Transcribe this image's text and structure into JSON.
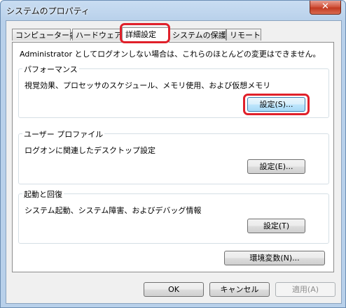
{
  "window": {
    "title": "システムのプロパティ",
    "close_glyph": "✕"
  },
  "tabs": [
    {
      "label": "コンピューター名"
    },
    {
      "label": "ハードウェア"
    },
    {
      "label": "詳細設定"
    },
    {
      "label": "システムの保護"
    },
    {
      "label": "リモート"
    }
  ],
  "panel": {
    "notice": "Administrator としてログオンしない場合は、これらのほとんどの変更はできません。",
    "performance": {
      "label": "パフォーマンス",
      "description": "視覚効果、プロセッサのスケジュール、メモリ使用、および仮想メモリ",
      "button": "設定(S)..."
    },
    "user_profile": {
      "label": "ユーザー プロファイル",
      "description": "ログオンに関連したデスクトップ設定",
      "button": "設定(E)..."
    },
    "startup": {
      "label": "起動と回復",
      "description": "システム起動、システム障害、およびデバッグ情報",
      "button": "設定(T)"
    },
    "env_button": "環境変数(N)..."
  },
  "footer": {
    "ok": "OK",
    "cancel": "キャンセル",
    "apply": "適用(A)"
  },
  "colors": {
    "highlight": "#e0202a",
    "title_bar": "#b8d0ea"
  }
}
